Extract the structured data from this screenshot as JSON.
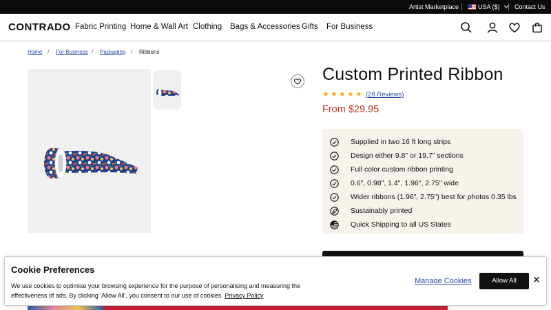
{
  "topbar": {
    "artist_marketplace": "Artist Marketplace",
    "region": "USA ($)",
    "contact": "Contact Us"
  },
  "header": {
    "logo": "CONTRADO",
    "nav": [
      "Fabric Printing",
      "Home & Wall Art",
      "Clothing",
      "Bags & Accessories",
      "Gifts",
      "For Business"
    ],
    "icons": [
      "search-icon",
      "account-icon",
      "heart-icon",
      "bag-icon"
    ]
  },
  "breadcrumb": {
    "items": [
      "Home",
      "For Business",
      "Packaging",
      "Ribbons"
    ],
    "separator": "/"
  },
  "product": {
    "title": "Custom Printed Ribbon",
    "rating": 5,
    "reviews": "(28 Reviews)",
    "price": "From $29.95",
    "features": [
      {
        "icon": "check-circle-icon",
        "text": "Supplied in two 16 ft long strips"
      },
      {
        "icon": "check-circle-icon",
        "text": "Design either 9.8\" or 19.7\" sections"
      },
      {
        "icon": "check-circle-icon",
        "text": "Full color custom ribbon printing"
      },
      {
        "icon": "check-circle-icon",
        "text": "0.6\", 0.98\", 1.4\", 1.96\", 2.75\" wide"
      },
      {
        "icon": "check-circle-icon",
        "text": "Wider ribbons (1.96\", 2.75\") best for photos 0.35 lbs"
      },
      {
        "icon": "leaf-icon",
        "text": "Sustainably printed"
      },
      {
        "icon": "us-flag-icon",
        "text": "Quick Shipping to all US States"
      }
    ]
  },
  "cookie": {
    "title": "Cookie Preferences",
    "text": "We use cookies to optimise your browsing experience for the purpose of personalising and measuring the effectiveness of ads. By clicking 'Allow All', you consent to our use of cookies.",
    "privacy_link": "Privacy Policy",
    "manage": "Manage Cookies",
    "allow": "Allow All",
    "close": "✕"
  },
  "colors": {
    "price_red": "#c4362b",
    "link_blue": "#2a4ca8",
    "star_gold": "#f1b21b",
    "features_bg": "#f7f2ec"
  }
}
